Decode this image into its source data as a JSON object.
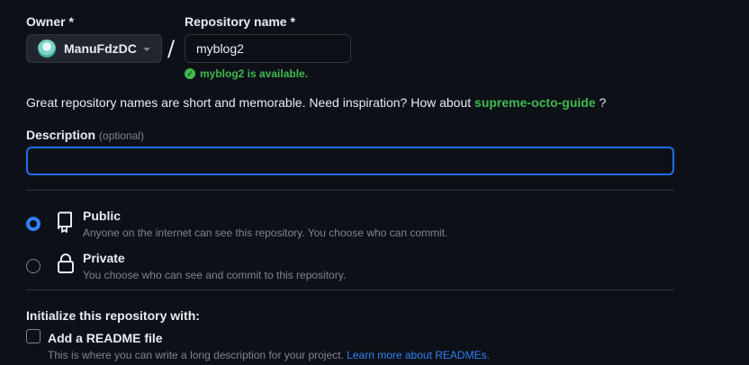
{
  "owner": {
    "label": "Owner *",
    "value": "ManuFdzDC"
  },
  "separator": "/",
  "repo": {
    "label": "Repository name *",
    "value": "myblog2",
    "availability": "myblog2 is available."
  },
  "hint": {
    "text": "Great repository names are short and memorable. Need inspiration? How about ",
    "suggestion": "supreme-octo-guide",
    "suffix": " ?"
  },
  "description": {
    "label": "Description",
    "optional": "(optional)",
    "value": ""
  },
  "visibility": {
    "public": {
      "title": "Public",
      "subtitle": "Anyone on the internet can see this repository. You choose who can commit.",
      "selected": true
    },
    "private": {
      "title": "Private",
      "subtitle": "You choose who can see and commit to this repository.",
      "selected": false
    }
  },
  "init": {
    "heading": "Initialize this repository with:",
    "readme_label": "Add a README file",
    "readme_desc": "This is where you can write a long description for your project.",
    "readme_link": "Learn more about READMEs."
  },
  "colors": {
    "background": "#0d1117",
    "accent_blue": "#2f81f7",
    "success_green": "#3fb950",
    "muted": "#7d8590"
  }
}
